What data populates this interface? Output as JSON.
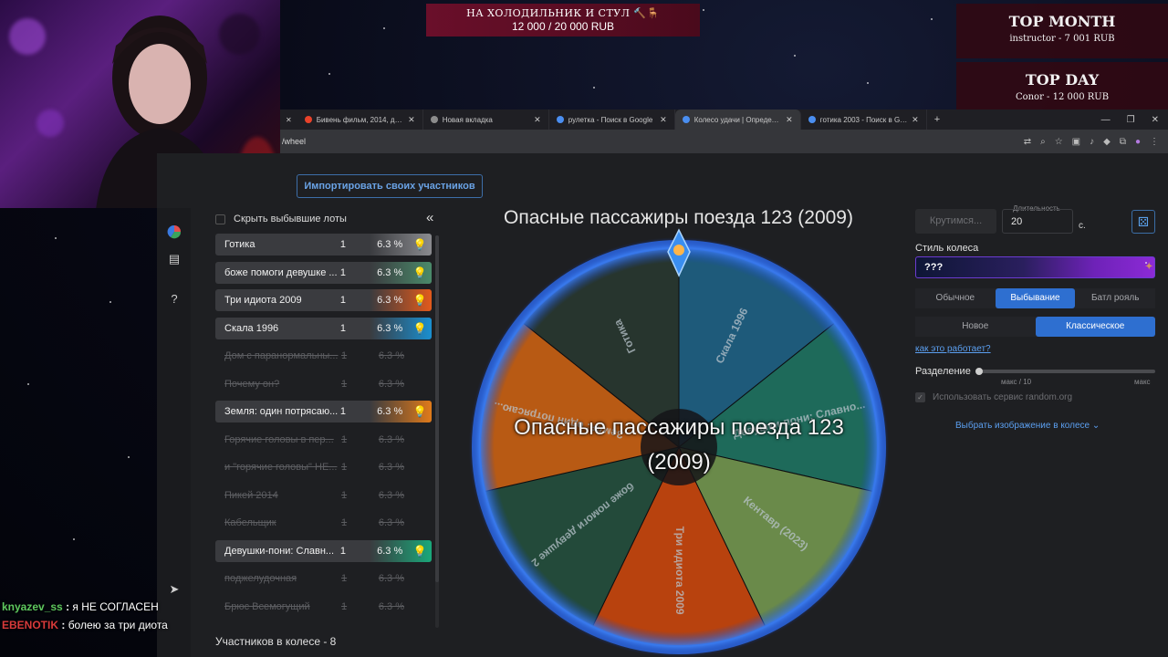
{
  "donation": {
    "title": "НА ХОЛОДИЛЬНИК И СТУЛ 🔨🪑",
    "amount": "12 000 / 20 000 RUB"
  },
  "top_month": {
    "title": "TOP MONTH",
    "entry": "instructor - 7 001 RUB"
  },
  "top_day": {
    "title": "TOP DAY",
    "entry": "Conor - 12 000 RUB"
  },
  "browser": {
    "tabs": [
      {
        "label": "Бивень фильм, 2014, дата вых",
        "color": "#e8422a"
      },
      {
        "label": "Новая вкладка",
        "color": "#8c8c8c"
      },
      {
        "label": "рулетка - Поиск в Google",
        "color": "#4a8ef0"
      },
      {
        "label": "Колесо удачи | Определите п",
        "color": "#4a8ef0",
        "active": true
      },
      {
        "label": "готика 2003 - Поиск в Google",
        "color": "#4a8ef0"
      }
    ],
    "url": "/wheel"
  },
  "import_button": "Импортировать своих участников",
  "lots_panel": {
    "hide_label": "Скрыть выбывшие лоты",
    "lots": [
      {
        "name": "Готика",
        "count": "1",
        "pct": "6.3 %",
        "active": true,
        "color": "#8a8b8f"
      },
      {
        "name": "боже помоги девушке ...",
        "count": "1",
        "pct": "6.3 %",
        "active": true,
        "color": "#4a8a6a"
      },
      {
        "name": "Три идиота 2009",
        "count": "1",
        "pct": "6.3 %",
        "active": true,
        "color": "#e25a1c"
      },
      {
        "name": "Скала 1996",
        "count": "1",
        "pct": "6.3 %",
        "active": true,
        "color": "#1a8fd0"
      },
      {
        "name": "Дом с паранормальны...",
        "count": "1",
        "pct": "6.3 %",
        "active": false
      },
      {
        "name": "Почему он?",
        "count": "1",
        "pct": "6.3 %",
        "active": false
      },
      {
        "name": "Земля: один потрясаю...",
        "count": "1",
        "pct": "6.3 %",
        "active": true,
        "color": "#e07a1a"
      },
      {
        "name": "Горячие головы в пер...",
        "count": "1",
        "pct": "6.3 %",
        "active": false
      },
      {
        "name": "и \"горячие головы\" НЕ...",
        "count": "1",
        "pct": "6.3 %",
        "active": false
      },
      {
        "name": "Пикей 2014",
        "count": "1",
        "pct": "6.3 %",
        "active": false
      },
      {
        "name": "Кабельщик",
        "count": "1",
        "pct": "6.3 %",
        "active": false
      },
      {
        "name": "Девушки-пони: Славн...",
        "count": "1",
        "pct": "6.3 %",
        "active": true,
        "color": "#1aa87a"
      },
      {
        "name": "поджелудочная",
        "count": "1",
        "pct": "6.3 %",
        "active": false
      },
      {
        "name": "Брюс Всемогущий",
        "count": "1",
        "pct": "6.3 %",
        "active": false
      }
    ],
    "participants": "Участников в колесе - 8"
  },
  "wheel": {
    "title": "Опасные пассажиры поезда 123 (2009)",
    "center_text_line1": "Опасные пассажиры поезда 123",
    "center_text_line2": "(2009)",
    "segments": [
      {
        "label": "Скала 1996",
        "color": "#1e5a7a"
      },
      {
        "label": "Девушки-пони: Славно...",
        "color": "#1e6a5a"
      },
      {
        "label": "Кентавр (2023)",
        "color": "#6a8a4a"
      },
      {
        "label": "Три идиота 2009",
        "color": "#b8420e"
      },
      {
        "label": "боже помоги девушке 2",
        "color": "#234a3a"
      },
      {
        "label": "Земля: один потрясаю...",
        "color": "#b85a14"
      },
      {
        "label": "Готика",
        "color": "#27352e"
      }
    ]
  },
  "controls": {
    "spin_button": "Крутимся...",
    "duration_label": "Длительность",
    "duration_value": "20",
    "duration_unit": "с.",
    "style_label": "Стиль колеса",
    "style_value": "???",
    "modes": [
      "Обычное",
      "Выбывание",
      "Батл рояль"
    ],
    "mode_selected": 1,
    "kinds": [
      "Новое",
      "Классическое"
    ],
    "kind_selected": 1,
    "howto_link": "как это работает?",
    "split_label": "Разделение",
    "split_min": "макс / 10",
    "split_max": "макс",
    "random_org": "Использовать сервис random.org",
    "choose_image": "Выбрать изображение в колесе"
  },
  "chat": [
    {
      "user": "knyazev_ss",
      "text": "я НЕ СОГЛАСЕН"
    },
    {
      "user": "EBENOTIK",
      "text": "болею за три диота"
    }
  ]
}
